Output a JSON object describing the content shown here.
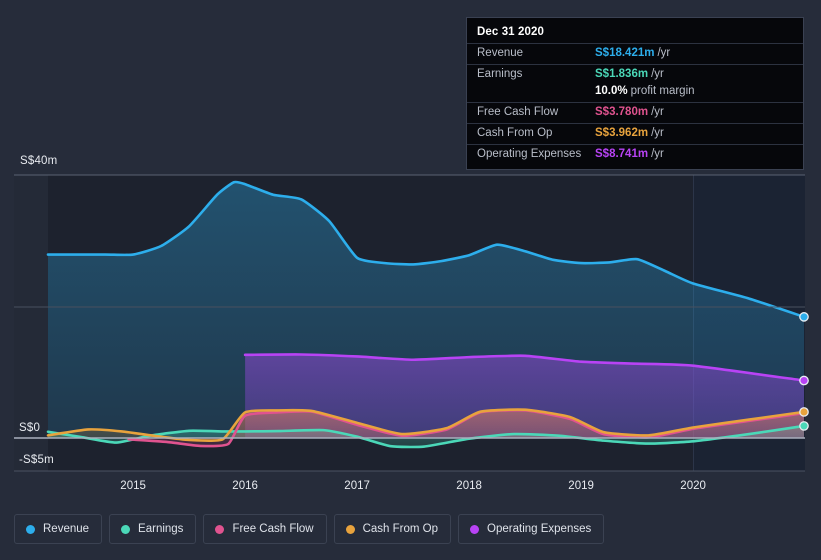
{
  "tooltip": {
    "title": "Dec 31 2020",
    "rows": [
      {
        "key": "Revenue",
        "value": "S$18.421m",
        "unit": "/yr",
        "color": "#2daeec"
      },
      {
        "key": "Earnings",
        "value": "S$1.836m",
        "unit": "/yr",
        "color": "#4bd8b8"
      },
      {
        "key": "",
        "value": "10.0%",
        "unit": "profit margin",
        "color": "#ffffff"
      },
      {
        "key": "Free Cash Flow",
        "value": "S$3.780m",
        "unit": "/yr",
        "color": "#e0538f"
      },
      {
        "key": "Cash From Op",
        "value": "S$3.962m",
        "unit": "/yr",
        "color": "#e8a33d"
      },
      {
        "key": "Operating Expenses",
        "value": "S$8.741m",
        "unit": "/yr",
        "color": "#b843f5"
      }
    ]
  },
  "legend": {
    "items": [
      {
        "label": "Revenue",
        "color": "#2daeec"
      },
      {
        "label": "Earnings",
        "color": "#4bd8b8"
      },
      {
        "label": "Free Cash Flow",
        "color": "#e0538f"
      },
      {
        "label": "Cash From Op",
        "color": "#e8a33d"
      },
      {
        "label": "Operating Expenses",
        "color": "#b843f5"
      }
    ]
  },
  "axes": {
    "y_labels": [
      "S$40m",
      "S$0",
      "-S$5m"
    ],
    "x_labels": [
      "2015",
      "2016",
      "2017",
      "2018",
      "2019",
      "2020"
    ]
  },
  "chart_data": {
    "type": "area",
    "title": "",
    "xlabel": "",
    "ylabel": "S$ millions",
    "ylim": [
      -5,
      40
    ],
    "y_ticks": [
      40,
      20,
      0,
      -5
    ],
    "y_tick_labels": [
      "S$40m",
      "",
      "S$0",
      "-S$5m"
    ],
    "grid": true,
    "legend_position": "bottom",
    "x_tick_labels": [
      "2015",
      "2016",
      "2017",
      "2018",
      "2019",
      "2020"
    ],
    "x_tick_values": [
      2015,
      2016,
      2017,
      2018,
      2019,
      2020
    ],
    "currency": "S$",
    "units": "millions",
    "series": [
      {
        "name": "Revenue",
        "color": "#2daeec",
        "x": [
          2014.24,
          2014.75,
          2015.0,
          2015.25,
          2015.5,
          2015.75,
          2015.9,
          2016.0,
          2016.25,
          2016.5,
          2016.75,
          2017.0,
          2017.25,
          2017.5,
          2017.75,
          2018.0,
          2018.25,
          2018.5,
          2018.75,
          2019.0,
          2019.25,
          2019.5,
          2019.75,
          2020.0,
          2020.5,
          2020.99
        ],
        "values": [
          27.9,
          27.9,
          27.9,
          29.2,
          32.2,
          37.0,
          38.9,
          38.6,
          37.0,
          36.3,
          33.0,
          27.4,
          26.6,
          26.4,
          26.9,
          27.8,
          29.4,
          28.4,
          27.1,
          26.6,
          26.7,
          27.2,
          25.4,
          23.5,
          21.2,
          18.421
        ]
      },
      {
        "name": "Operating Expenses",
        "color": "#b843f5",
        "x": [
          2016.0,
          2016.5,
          2017.0,
          2017.5,
          2018.0,
          2018.5,
          2019.0,
          2019.5,
          2020.0,
          2020.99
        ],
        "values": [
          12.65,
          12.7,
          12.4,
          11.9,
          12.3,
          12.5,
          11.6,
          11.3,
          11.0,
          8.741
        ]
      },
      {
        "name": "Cash From Op",
        "color": "#e8a33d",
        "x": [
          2014.24,
          2014.6,
          2014.9,
          2015.2,
          2015.5,
          2015.8,
          2016.0,
          2016.3,
          2016.6,
          2017.0,
          2017.4,
          2017.8,
          2018.1,
          2018.5,
          2018.9,
          2019.2,
          2019.6,
          2020.0,
          2020.5,
          2020.99
        ],
        "values": [
          0.4,
          1.3,
          1.0,
          0.3,
          -0.3,
          -0.2,
          3.9,
          4.2,
          4.1,
          2.3,
          0.6,
          1.5,
          4.0,
          4.3,
          3.2,
          0.9,
          0.4,
          1.6,
          2.8,
          3.962
        ]
      },
      {
        "name": "Free Cash Flow",
        "color": "#e0538f",
        "x": [
          2014.96,
          2015.3,
          2015.6,
          2015.85,
          2016.0,
          2016.3,
          2016.6,
          2017.0,
          2017.4,
          2017.8,
          2018.1,
          2018.5,
          2018.9,
          2019.2,
          2019.6,
          2020.0,
          2020.5,
          2020.99
        ],
        "values": [
          -0.2,
          -0.6,
          -1.2,
          -0.9,
          3.4,
          3.9,
          4.0,
          2.0,
          0.35,
          1.3,
          3.9,
          4.2,
          2.9,
          0.6,
          0.1,
          1.4,
          2.6,
          3.78
        ]
      },
      {
        "name": "Earnings",
        "color": "#4bd8b8",
        "x": [
          2014.24,
          2014.55,
          2014.85,
          2015.15,
          2015.5,
          2015.8,
          2016.0,
          2016.3,
          2016.7,
          2017.0,
          2017.3,
          2017.6,
          2018.0,
          2018.4,
          2018.8,
          2019.2,
          2019.6,
          2020.0,
          2020.5,
          2020.99
        ],
        "values": [
          0.95,
          0.1,
          -0.7,
          0.35,
          1.1,
          1.0,
          1.0,
          1.05,
          1.2,
          0.2,
          -1.25,
          -1.3,
          -0.1,
          0.6,
          0.35,
          -0.4,
          -0.85,
          -0.5,
          0.6,
          1.836
        ]
      }
    ],
    "end_markers": [
      {
        "name": "Revenue",
        "value": 18.421,
        "color": "#2daeec"
      },
      {
        "name": "Operating Expenses",
        "value": 8.741,
        "color": "#b843f5"
      },
      {
        "name": "Cash From Op",
        "value": 3.962,
        "color": "#e8a33d"
      },
      {
        "name": "Earnings",
        "value": 1.836,
        "color": "#4bd8b8"
      }
    ]
  }
}
